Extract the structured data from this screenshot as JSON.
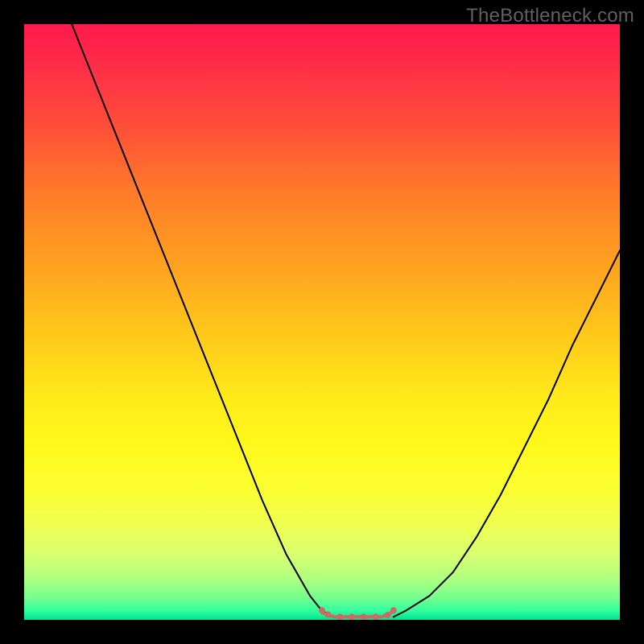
{
  "watermark": "TheBottleneck.com",
  "chart_data": {
    "type": "line",
    "title": "",
    "xlabel": "",
    "ylabel": "",
    "xlim": [
      0,
      100
    ],
    "ylim": [
      0,
      100
    ],
    "background_gradient": {
      "direction": "vertical",
      "stops": [
        {
          "pos": 0,
          "color": "#ff1a4a"
        },
        {
          "pos": 50,
          "color": "#ffc81a"
        },
        {
          "pos": 85,
          "color": "#e0ff50"
        },
        {
          "pos": 100,
          "color": "#00e090"
        }
      ]
    },
    "series": [
      {
        "name": "left_branch",
        "stroke": "#000000",
        "x": [
          8,
          12,
          16,
          20,
          24,
          28,
          32,
          36,
          40,
          44,
          48,
          50,
          52
        ],
        "y": [
          100,
          90,
          80,
          70,
          60,
          50,
          40,
          30,
          20,
          11,
          4,
          1.5,
          0.5
        ]
      },
      {
        "name": "right_branch",
        "stroke": "#000000",
        "x": [
          62,
          64,
          68,
          72,
          76,
          80,
          84,
          88,
          92,
          96,
          100
        ],
        "y": [
          0.5,
          1.5,
          4,
          8,
          14,
          21,
          29,
          37,
          46,
          54,
          62
        ]
      },
      {
        "name": "bottom_flat_marker",
        "stroke": "#cc6b63",
        "stroke_width": 4,
        "x": [
          50,
          52,
          54,
          56,
          58,
          60,
          62
        ],
        "y": [
          1.2,
          0.5,
          0.5,
          0.5,
          0.5,
          0.5,
          1.4
        ]
      }
    ],
    "marker_dots": {
      "color": "#cc6b63",
      "radius": 4,
      "points": [
        {
          "x": 50,
          "y": 1.6
        },
        {
          "x": 51,
          "y": 0.9
        },
        {
          "x": 53,
          "y": 0.5
        },
        {
          "x": 55,
          "y": 0.5
        },
        {
          "x": 57,
          "y": 0.5
        },
        {
          "x": 59,
          "y": 0.5
        },
        {
          "x": 61,
          "y": 0.8
        },
        {
          "x": 62,
          "y": 1.6
        }
      ]
    }
  }
}
